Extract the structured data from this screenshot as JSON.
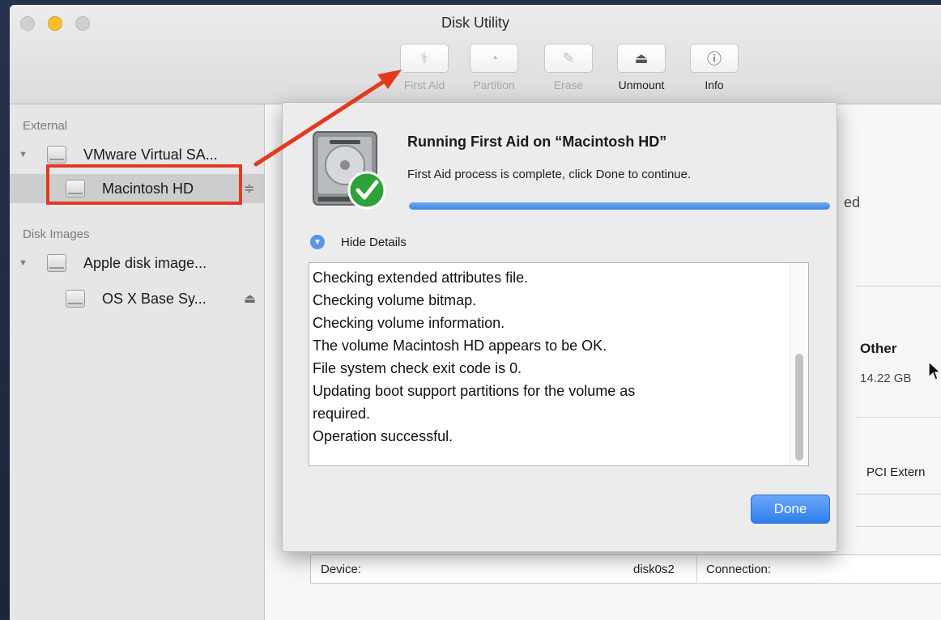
{
  "window": {
    "title": "Disk Utility"
  },
  "toolbar": [
    {
      "label": "First Aid",
      "icon": "stethoscope-icon",
      "glyph": "⚕",
      "enabled": false
    },
    {
      "label": "Partition",
      "icon": "partition-icon",
      "glyph": "◔",
      "enabled": false
    },
    {
      "label": "Erase",
      "icon": "erase-icon",
      "glyph": "✎",
      "enabled": false
    },
    {
      "label": "Unmount",
      "icon": "unmount-icon",
      "glyph": "⏏",
      "enabled": true
    },
    {
      "label": "Info",
      "icon": "info-icon",
      "glyph": "ⓘ",
      "enabled": true
    }
  ],
  "sidebar": {
    "external_label": "External",
    "disk_images_label": "Disk Images",
    "items": [
      {
        "name": "VMware Virtual SA...",
        "level": 0,
        "expanded": true
      },
      {
        "name": "Macintosh HD",
        "level": 1,
        "selected": true,
        "eject": "≑"
      },
      {
        "name": "Apple disk image...",
        "level": 0,
        "expanded": true
      },
      {
        "name": "OS X Base Sy...",
        "level": 1,
        "eject": "⏏"
      }
    ]
  },
  "background": {
    "partial_text": "ed",
    "other_label": "Other",
    "other_size": "14.22 GB",
    "connection_partial": "PCI Extern",
    "device_label": "Device:",
    "device_value": "disk0s2",
    "connection_label": "Connection:"
  },
  "sheet": {
    "title": "Running First Aid on “Macintosh HD”",
    "message": "First Aid process is complete, click Done to continue.",
    "progress": 1.0,
    "details_toggle": "Hide Details",
    "log": [
      "Checking extended attributes file.",
      "Checking volume bitmap.",
      "Checking volume information.",
      "The volume Macintosh HD appears to be OK.",
      "File system check exit code is 0.",
      "Updating boot support partitions for the volume as",
      "required.",
      "Operation successful."
    ],
    "done_label": "Done"
  },
  "colors": {
    "annotation_red": "#e23a1f",
    "accent_blue": "#3e84e6"
  }
}
